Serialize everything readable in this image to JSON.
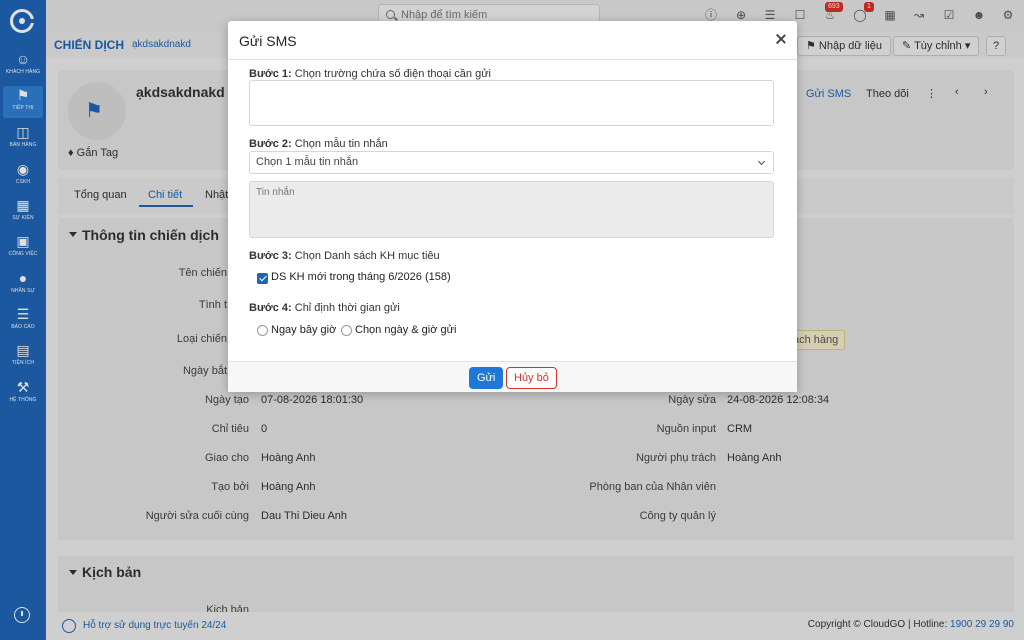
{
  "app": {
    "accent": "#1f65b6"
  },
  "sidebar": {
    "items": [
      {
        "label": "KHÁCH HÀNG",
        "icon": "users-icon"
      },
      {
        "label": "TIẾP THỊ",
        "icon": "megaphone-icon"
      },
      {
        "label": "BÁN HÀNG",
        "icon": "cart-icon"
      },
      {
        "label": "CSKH",
        "icon": "support-icon"
      },
      {
        "label": "SỰ KIỆN",
        "icon": "calendar-icon"
      },
      {
        "label": "CÔNG VIỆC",
        "icon": "briefcase-icon"
      },
      {
        "label": "NHÂN SỰ",
        "icon": "person-icon"
      },
      {
        "label": "BÁO CÁO",
        "icon": "report-icon"
      },
      {
        "label": "TIỆN ÍCH",
        "icon": "toolbox-icon"
      },
      {
        "label": "HỆ THỐNG",
        "icon": "wrench-icon"
      }
    ]
  },
  "topbar": {
    "search_placeholder": "Nhập để tìm kiếm",
    "notification_count": "693",
    "chat_count": "1"
  },
  "header": {
    "module": "CHIẾN DỊCH",
    "record": "ạkdsakdnakd",
    "import_label": "Nhập dữ liệu",
    "customize_label": "Tùy chỉnh"
  },
  "record": {
    "title": "ạkdsakdnakd",
    "tag_label": "Gắn Tag",
    "send_sms": "Gửi SMS",
    "follow": "Theo dõi"
  },
  "tabs": [
    "Tổng quan",
    "Chi tiết",
    "Nhật"
  ],
  "section_info": "Thông tin chiến dịch",
  "left_fields": [
    {
      "label": "Tên chiến",
      "value": ""
    },
    {
      "label": "Tình t",
      "value": ""
    },
    {
      "label": "Loại chiến",
      "value": ""
    },
    {
      "label": "Ngày bắt",
      "value": ""
    },
    {
      "label": "Ngày tạo",
      "value": "07-08-2026 18:01:30"
    },
    {
      "label": "Chỉ tiêu",
      "value": "0"
    },
    {
      "label": "Giao cho",
      "value": "Hoàng Anh"
    },
    {
      "label": "Tạo bởi",
      "value": "Hoàng Anh"
    },
    {
      "label": "Người sửa cuối cùng",
      "value": "Dau Thi Dieu Anh"
    }
  ],
  "right_fields": [
    {
      "label": "Ngày sửa",
      "value": "24-08-2026 12:08:34"
    },
    {
      "label": "Nguồn input",
      "value": "CRM"
    },
    {
      "label": "Người phụ trách",
      "value": "Hoàng Anh"
    },
    {
      "label": "Phòng ban của Nhân viên",
      "value": ""
    },
    {
      "label": "Công ty quản lý",
      "value": ""
    }
  ],
  "chip_text": "ách hàng",
  "section_script": "Kịch bản",
  "script_label": "Kịch bản",
  "footer": {
    "support": "Hỗ trợ sử dụng trực tuyến 24/24",
    "copyright": "Copyright © CloudGO | Hotline: ",
    "hotline": "1900 29 29 90"
  },
  "modal": {
    "title": "Gửi SMS",
    "step1_prefix": "Bước 1:",
    "step1_text": "Chọn trường chứa số điện thoại cần gửi",
    "step2_prefix": "Bước 2:",
    "step2_text": "Chọn mẫu tin nhắn",
    "template_select": "Chọn 1 mẫu tin nhắn",
    "message_placeholder": "Tin nhắn",
    "step3_prefix": "Bước 3:",
    "step3_text": "Chọn Danh sách KH mục tiêu",
    "target_list": "DS KH mới trong tháng 6/2026 (158)",
    "step4_prefix": "Bước 4:",
    "step4_text": "Chỉ định thời gian gửi",
    "option_now": "Ngay bây giờ",
    "option_schedule": "Chọn ngày & giờ gửi",
    "send_button": "Gửi",
    "cancel_button": "Hủy bỏ"
  }
}
